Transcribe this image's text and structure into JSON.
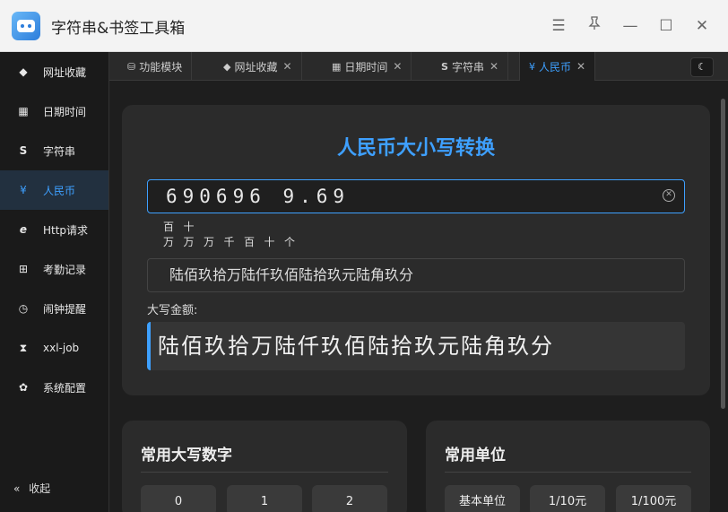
{
  "app": {
    "title": "字符串&书签工具箱"
  },
  "sidebar": {
    "items": [
      {
        "label": "网址收藏",
        "icon": "tag-icon"
      },
      {
        "label": "日期时间",
        "icon": "calendar-icon"
      },
      {
        "label": "字符串",
        "icon": "string-s-icon"
      },
      {
        "label": "人民币",
        "icon": "yuan-icon"
      },
      {
        "label": "Http请求",
        "icon": "ie-icon"
      },
      {
        "label": "考勤记录",
        "icon": "grid-icon"
      },
      {
        "label": "闹钟提醒",
        "icon": "clock-icon"
      },
      {
        "label": "xxl-job",
        "icon": "hourglass-icon"
      },
      {
        "label": "系统配置",
        "icon": "gear-icon"
      }
    ],
    "collapse_label": "收起"
  },
  "tabs": [
    {
      "label": "功能模块",
      "closable": false
    },
    {
      "label": "网址收藏",
      "closable": true
    },
    {
      "label": "日期时间",
      "closable": true
    },
    {
      "label": "字符串",
      "closable": true
    },
    {
      "label": "人民币",
      "closable": true
    }
  ],
  "converter": {
    "title": "人民币大小写转换",
    "input_value": "690696 9.69",
    "units_row1": [
      "百",
      "十"
    ],
    "units_row2": [
      "万",
      "万",
      "万",
      "千",
      "百",
      "十",
      "个"
    ],
    "preview": "陆佰玖拾万陆仟玖佰陆拾玖元陆角玖分",
    "result_label": "大写金额:",
    "result": "陆佰玖拾万陆仟玖佰陆拾玖元陆角玖分"
  },
  "digits_card": {
    "title": "常用大写数字",
    "chips": [
      "0",
      "1",
      "2"
    ]
  },
  "units_card": {
    "title": "常用单位",
    "chips": [
      "基本单位",
      "1/10元",
      "1/100元"
    ]
  },
  "colors": {
    "accent": "#3ea0ff",
    "background": "#1e1e1e",
    "card": "#2b2b2b"
  }
}
